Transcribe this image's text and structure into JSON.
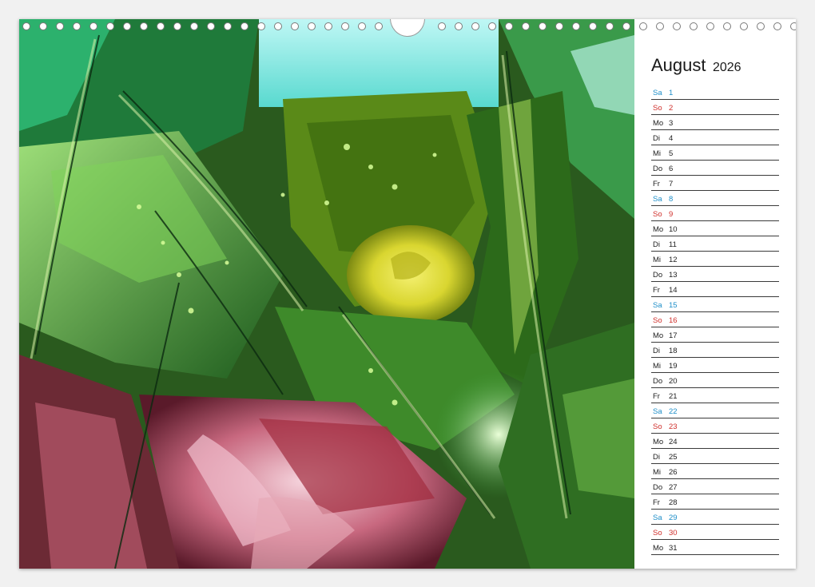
{
  "calendar": {
    "month": "August",
    "year": "2026",
    "days": [
      {
        "wd": "Sa",
        "d": "1",
        "type": "sat"
      },
      {
        "wd": "So",
        "d": "2",
        "type": "sun"
      },
      {
        "wd": "Mo",
        "d": "3",
        "type": "week"
      },
      {
        "wd": "Di",
        "d": "4",
        "type": "week"
      },
      {
        "wd": "Mi",
        "d": "5",
        "type": "week"
      },
      {
        "wd": "Do",
        "d": "6",
        "type": "week"
      },
      {
        "wd": "Fr",
        "d": "7",
        "type": "week"
      },
      {
        "wd": "Sa",
        "d": "8",
        "type": "sat"
      },
      {
        "wd": "So",
        "d": "9",
        "type": "sun"
      },
      {
        "wd": "Mo",
        "d": "10",
        "type": "week"
      },
      {
        "wd": "Di",
        "d": "11",
        "type": "week"
      },
      {
        "wd": "Mi",
        "d": "12",
        "type": "week"
      },
      {
        "wd": "Do",
        "d": "13",
        "type": "week"
      },
      {
        "wd": "Fr",
        "d": "14",
        "type": "week"
      },
      {
        "wd": "Sa",
        "d": "15",
        "type": "sat"
      },
      {
        "wd": "So",
        "d": "16",
        "type": "sun"
      },
      {
        "wd": "Mo",
        "d": "17",
        "type": "week"
      },
      {
        "wd": "Di",
        "d": "18",
        "type": "week"
      },
      {
        "wd": "Mi",
        "d": "19",
        "type": "week"
      },
      {
        "wd": "Do",
        "d": "20",
        "type": "week"
      },
      {
        "wd": "Fr",
        "d": "21",
        "type": "week"
      },
      {
        "wd": "Sa",
        "d": "22",
        "type": "sat"
      },
      {
        "wd": "So",
        "d": "23",
        "type": "sun"
      },
      {
        "wd": "Mo",
        "d": "24",
        "type": "week"
      },
      {
        "wd": "Di",
        "d": "25",
        "type": "week"
      },
      {
        "wd": "Mi",
        "d": "26",
        "type": "week"
      },
      {
        "wd": "Do",
        "d": "27",
        "type": "week"
      },
      {
        "wd": "Fr",
        "d": "28",
        "type": "week"
      },
      {
        "wd": "Sa",
        "d": "29",
        "type": "sat"
      },
      {
        "wd": "So",
        "d": "30",
        "type": "sun"
      },
      {
        "wd": "Mo",
        "d": "31",
        "type": "week"
      }
    ]
  },
  "colors": {
    "saturday": "#1f8fc9",
    "sunday": "#d0312d",
    "weekday": "#222222"
  }
}
